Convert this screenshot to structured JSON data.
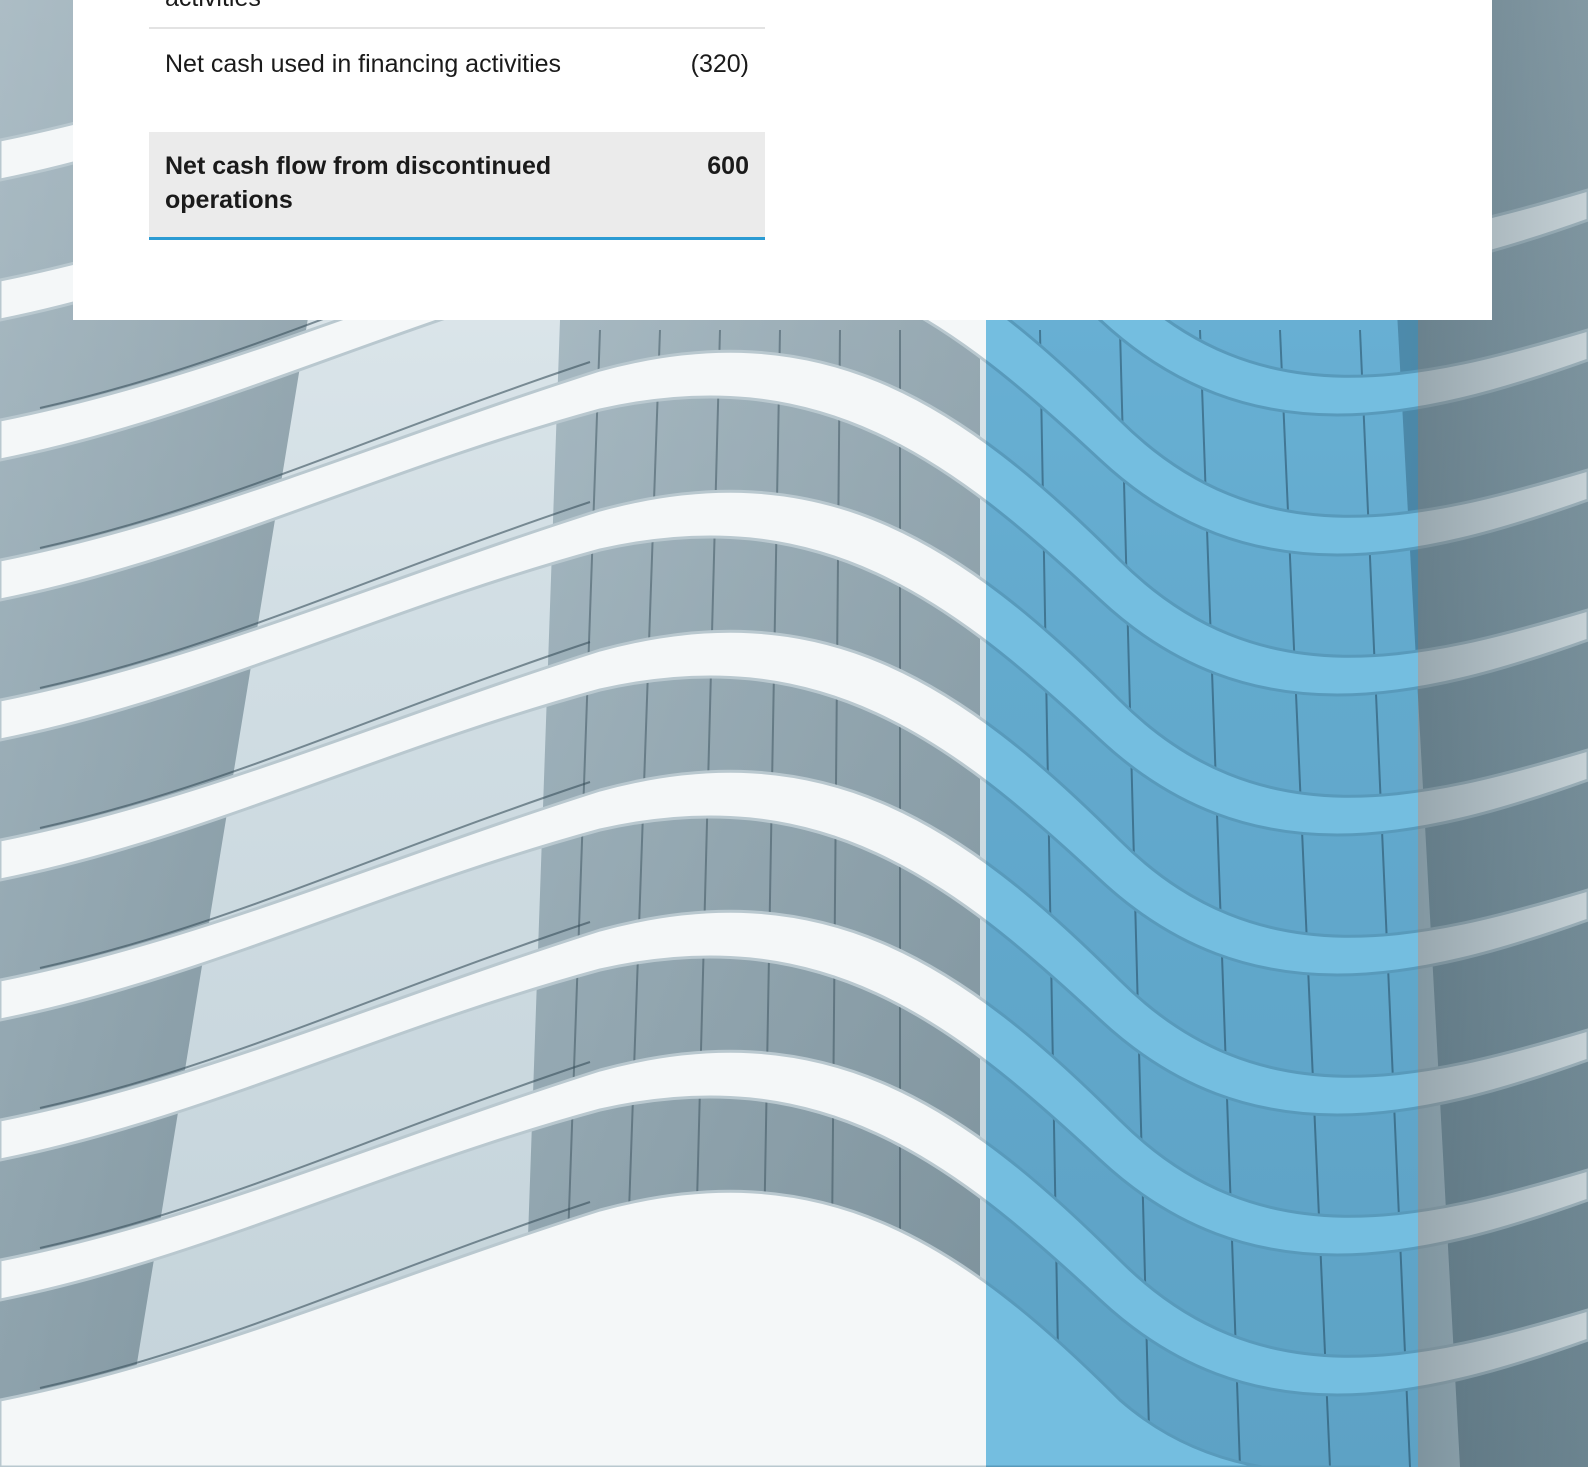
{
  "cash_flow_table": {
    "rows": [
      {
        "label": "activities",
        "value": ""
      },
      {
        "label": "Net cash used in financing activities",
        "value": "(320)"
      },
      {
        "label": "Net cash flow from discontinued operations",
        "value": "600"
      }
    ]
  },
  "background": {
    "description": "curved white balconies facade",
    "accent_color": "#2b9bd3",
    "overlay_color": "#26a0d8"
  }
}
